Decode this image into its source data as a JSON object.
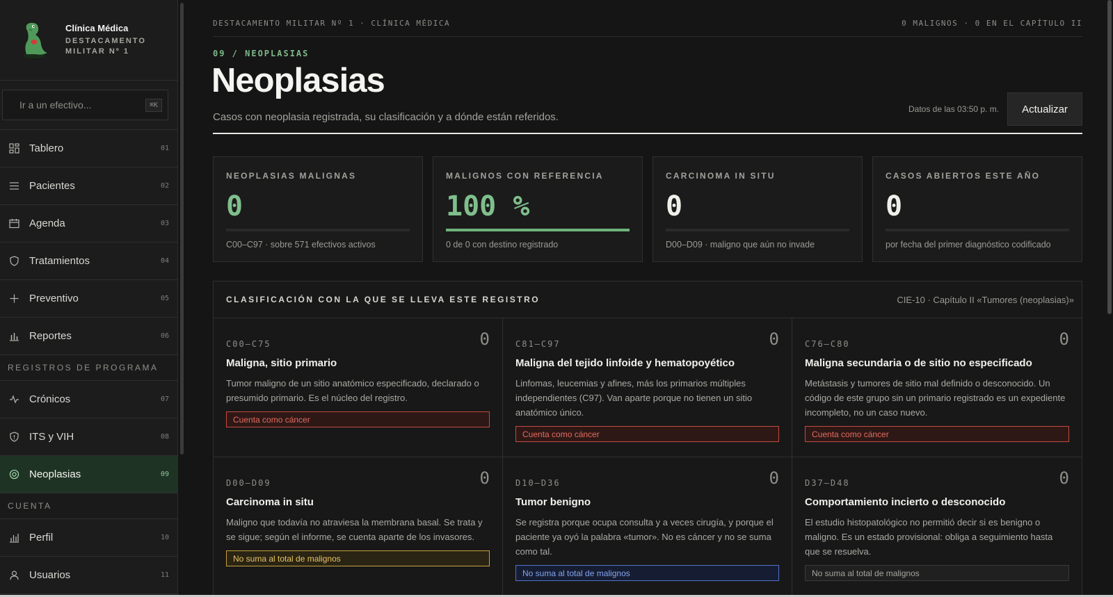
{
  "sidebar": {
    "brand_title": "Clínica Médica",
    "brand_subtitle": "DESTACAMENTO MILITAR Nº 1",
    "search_placeholder": "Ir a un efectivo...",
    "search_shortcut": "⌘K",
    "items": [
      {
        "label": "Tablero",
        "num": "01",
        "icon": "dashboard-icon"
      },
      {
        "label": "Pacientes",
        "num": "02",
        "icon": "list-icon"
      },
      {
        "label": "Agenda",
        "num": "03",
        "icon": "calendar-icon"
      },
      {
        "label": "Tratamientos",
        "num": "04",
        "icon": "shield-icon"
      },
      {
        "label": "Preventivo",
        "num": "05",
        "icon": "plus-icon"
      },
      {
        "label": "Reportes",
        "num": "06",
        "icon": "bar-chart-icon"
      }
    ],
    "section_program": "REGISTROS DE PROGRAMA",
    "program_items": [
      {
        "label": "Crónicos",
        "num": "07",
        "icon": "pulse-icon"
      },
      {
        "label": "ITS y VIH",
        "num": "08",
        "icon": "shield-alert-icon"
      },
      {
        "label": "Neoplasias",
        "num": "09",
        "icon": "target-icon",
        "active": true
      }
    ],
    "section_account": "CUENTA",
    "account_items": [
      {
        "label": "Perfil",
        "num": "10",
        "icon": "bar-chart-icon"
      },
      {
        "label": "Usuarios",
        "num": "11",
        "icon": "user-icon"
      }
    ]
  },
  "topbar": {
    "left": "DESTACAMENTO MILITAR Nº 1 · CLÍNICA MÉDICA",
    "right": "0 MALIGNOS · 0 EN EL CAPÍTULO II"
  },
  "header": {
    "eyebrow": "09 / NEOPLASIAS",
    "title": "Neoplasias",
    "subtitle": "Casos con neoplasia registrada, su clasificación y a dónde están referidos.",
    "updated": "Datos de las 03:50 p. m.",
    "refresh_label": "Actualizar"
  },
  "stats": [
    {
      "label": "NEOPLASIAS MALIGNAS",
      "value": "0",
      "note": "C00–C97 · sobre 571 efectivos activos",
      "progress": 0,
      "green": true
    },
    {
      "label": "MALIGNOS CON REFERENCIA",
      "value": "100 %",
      "note": "0 de 0 con destino registrado",
      "progress": 1,
      "green": true
    },
    {
      "label": "CARCINOMA IN SITU",
      "value": "0",
      "note": "D00–D09 · maligno que aún no invade",
      "progress": 0,
      "green": false
    },
    {
      "label": "CASOS ABIERTOS ESTE AÑO",
      "value": "0",
      "note": "por fecha del primer diagnóstico codificado",
      "progress": 0,
      "green": false
    }
  ],
  "classification": {
    "title": "CLASIFICACIÓN CON LA QUE SE LLEVA ESTE REGISTRO",
    "reference": "CIE-10 · Capítulo II «Tumores (neoplasias)»",
    "cells": [
      {
        "code": "C00–C75",
        "count": "0",
        "title": "Maligna, sitio primario",
        "desc": "Tumor maligno de un sitio anatómico especificado, declarado o presumido primario. Es el núcleo del registro.",
        "tag": "Cuenta como cáncer",
        "tag_style": "red"
      },
      {
        "code": "C81–C97",
        "count": "0",
        "title": "Maligna del tejido linfoide y hematopoyético",
        "desc": "Linfomas, leucemias y afines, más los primarios múltiples independientes (C97). Van aparte porque no tienen un sitio anatómico único.",
        "tag": "Cuenta como cáncer",
        "tag_style": "red"
      },
      {
        "code": "C76–C80",
        "count": "0",
        "title": "Maligna secundaria o de sitio no especificado",
        "desc": "Metástasis y tumores de sitio mal definido o desconocido. Un código de este grupo sin un primario registrado es un expediente incompleto, no un caso nuevo.",
        "tag": "Cuenta como cáncer",
        "tag_style": "red"
      },
      {
        "code": "D00–D09",
        "count": "0",
        "title": "Carcinoma in situ",
        "desc": "Maligno que todavía no atraviesa la membrana basal. Se trata y se sigue; según el informe, se cuenta aparte de los invasores.",
        "tag": "No suma al total de malignos",
        "tag_style": "amber"
      },
      {
        "code": "D10–D36",
        "count": "0",
        "title": "Tumor benigno",
        "desc": "Se registra porque ocupa consulta y a veces cirugía, y porque el paciente ya oyó la palabra «tumor». No es cáncer y no se suma como tal.",
        "tag": "No suma al total de malignos",
        "tag_style": "blue"
      },
      {
        "code": "D37–D48",
        "count": "0",
        "title": "Comportamiento incierto o desconocido",
        "desc": "El estudio histopatológico no permitió decir si es benigno o maligno. Es un estado provisional: obliga a seguimiento hasta que se resuelva.",
        "tag": "No suma al total de malignos",
        "tag_style": "gray"
      }
    ]
  }
}
